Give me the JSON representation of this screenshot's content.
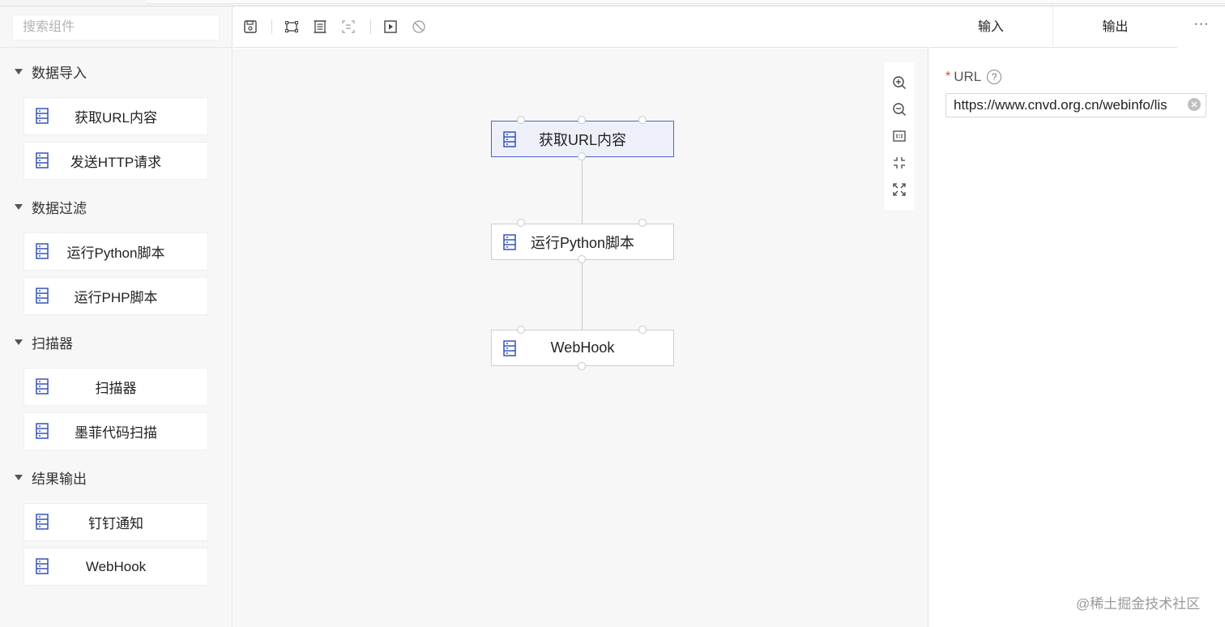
{
  "search": {
    "placeholder": "搜索组件"
  },
  "sidebar": {
    "groups": [
      {
        "title": "数据导入",
        "items": [
          "获取URL内容",
          "发送HTTP请求"
        ]
      },
      {
        "title": "数据过滤",
        "items": [
          "运行Python脚本",
          "运行PHP脚本"
        ]
      },
      {
        "title": "扫描器",
        "items": [
          "扫描器",
          "墨菲代码扫描"
        ]
      },
      {
        "title": "结果输出",
        "items": [
          "钉钉通知",
          "WebHook"
        ]
      }
    ]
  },
  "toolbar": {
    "icons": [
      "save-icon",
      "select-frame-icon",
      "page-icon",
      "align-icon",
      "run-icon",
      "disable-icon"
    ]
  },
  "canvas": {
    "nodes": [
      {
        "label": "获取URL内容",
        "selected": true
      },
      {
        "label": "运行Python脚本",
        "selected": false
      },
      {
        "label": "WebHook",
        "selected": false
      }
    ],
    "zoom_icons": [
      "zoom-in-icon",
      "zoom-out-icon",
      "actual-size-icon",
      "fit-icon",
      "fullscreen-icon"
    ]
  },
  "panel": {
    "tabs": [
      "输入",
      "输出"
    ],
    "more": "···",
    "field": {
      "required_mark": "*",
      "label": "URL",
      "help": "?",
      "value": "https://www.cnvd.org.cn/webinfo/lis"
    }
  },
  "watermark": "@稀土掘金技术社区",
  "colors": {
    "accent": "#4a63d0",
    "required": "#e0412d",
    "icon": "#3553b8"
  }
}
